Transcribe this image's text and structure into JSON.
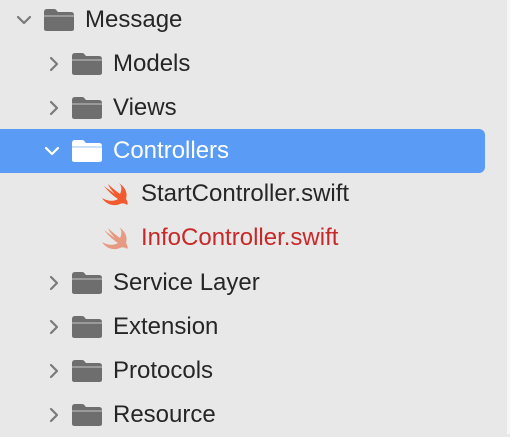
{
  "navigator": {
    "items": [
      {
        "label": "Message",
        "kind": "folder",
        "expanded": true,
        "depth": 0,
        "selected": false,
        "status": ""
      },
      {
        "label": "Models",
        "kind": "folder",
        "expanded": false,
        "depth": 1,
        "selected": false,
        "status": ""
      },
      {
        "label": "Views",
        "kind": "folder",
        "expanded": false,
        "depth": 1,
        "selected": false,
        "status": ""
      },
      {
        "label": "Controllers",
        "kind": "folder",
        "expanded": true,
        "depth": 1,
        "selected": true,
        "status": ""
      },
      {
        "label": "StartController.swift",
        "kind": "swift-file",
        "depth": 2,
        "selected": false,
        "status": ""
      },
      {
        "label": "InfoController.swift",
        "kind": "swift-file",
        "depth": 2,
        "selected": false,
        "status": "modified"
      },
      {
        "label": "Service Layer",
        "kind": "folder",
        "expanded": false,
        "depth": 1,
        "selected": false,
        "status": ""
      },
      {
        "label": "Extension",
        "kind": "folder",
        "expanded": false,
        "depth": 1,
        "selected": false,
        "status": ""
      },
      {
        "label": "Protocols",
        "kind": "folder",
        "expanded": false,
        "depth": 1,
        "selected": false,
        "status": ""
      },
      {
        "label": "Resource",
        "kind": "folder",
        "expanded": false,
        "depth": 1,
        "selected": false,
        "status": ""
      }
    ]
  },
  "colors": {
    "background": "#e8e8e8",
    "selection": "#5a9cf5",
    "folder_icon": "#6e6e6e",
    "swift_icon": "#f05a2e",
    "swift_icon_faded": "#e69a82",
    "modified_text": "#c82828"
  },
  "icons": {
    "folder": "folder-icon",
    "swift": "swift-icon",
    "collapsed": "chevron-right-icon",
    "expanded": "chevron-down-icon"
  }
}
